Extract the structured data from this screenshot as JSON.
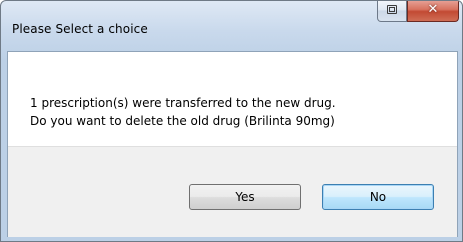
{
  "window": {
    "title": "Please Select a choice"
  },
  "titlebar_buttons": {
    "restore_icon": "restore-icon",
    "close_icon": "close-icon",
    "close_glyph": "✕"
  },
  "message": {
    "line1": "1 prescription(s) were transferred to the new drug.",
    "line2": "Do you want to delete the old drug (Brilinta 90mg)"
  },
  "buttons": {
    "yes_label": "Yes",
    "no_label": "No",
    "default": "No"
  },
  "colors": {
    "titlebar": "#c9d9ec",
    "close_button": "#c94a33",
    "button_area": "#f0f0f0",
    "default_button_border": "#3c7fb1"
  }
}
